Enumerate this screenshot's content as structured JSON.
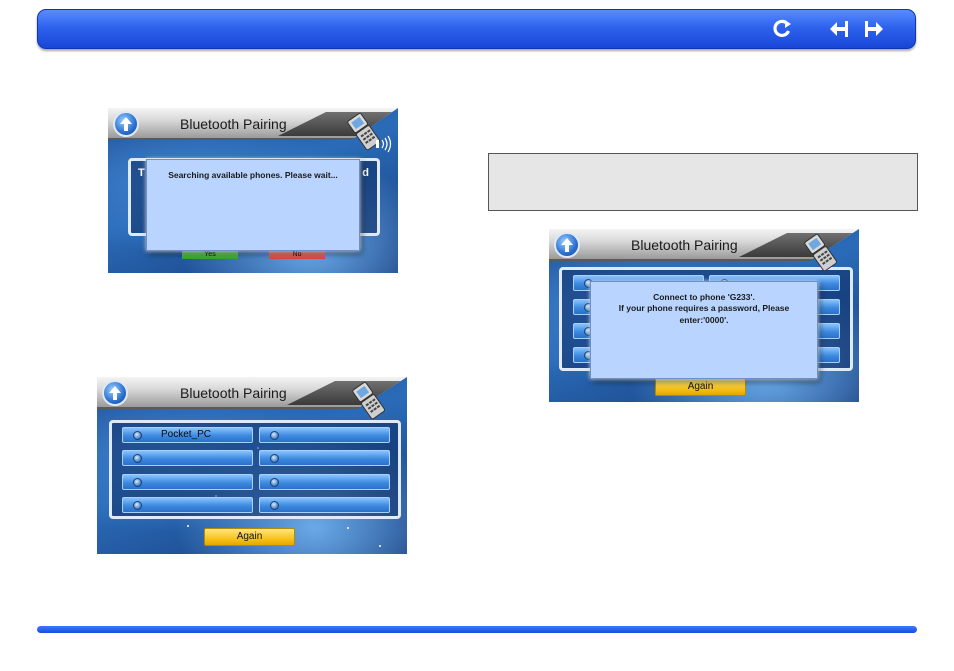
{
  "header": {
    "icons": [
      "back-icon",
      "previous-page-icon",
      "next-page-icon"
    ],
    "color": "#2e63ee"
  },
  "screens": {
    "searching": {
      "title": "Bluetooth Pairing",
      "dialog_text": "Searching available phones. Please wait...",
      "bg_letter_left": "T",
      "bg_letter_right": "d",
      "yes_label": "Yes",
      "no_label": "No"
    },
    "device_list": {
      "title": "Bluetooth Pairing",
      "slots": [
        "Pocket_PC",
        "",
        "",
        "",
        "",
        "",
        "",
        ""
      ],
      "again_label": "Again"
    },
    "connect": {
      "title": "Bluetooth Pairing",
      "dialog_line1": "Connect to phone 'G233'.",
      "dialog_line2": "If your phone requires a password, Please",
      "dialog_line3": "enter:'0000'.",
      "again_label": "Again"
    }
  },
  "note": {
    "text": ""
  }
}
